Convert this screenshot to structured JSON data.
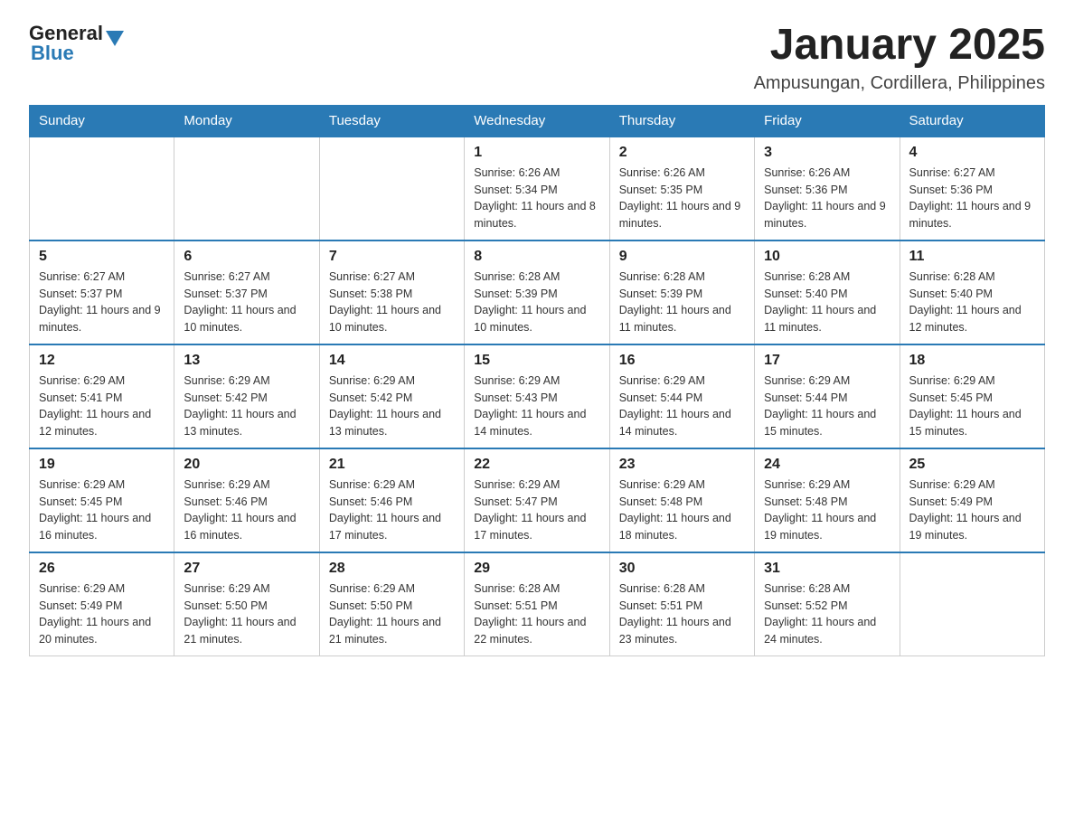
{
  "header": {
    "logo_general": "General",
    "logo_blue": "Blue",
    "title": "January 2025",
    "subtitle": "Ampusungan, Cordillera, Philippines"
  },
  "days_of_week": [
    "Sunday",
    "Monday",
    "Tuesday",
    "Wednesday",
    "Thursday",
    "Friday",
    "Saturday"
  ],
  "weeks": [
    [
      {
        "day": "",
        "info": ""
      },
      {
        "day": "",
        "info": ""
      },
      {
        "day": "",
        "info": ""
      },
      {
        "day": "1",
        "info": "Sunrise: 6:26 AM\nSunset: 5:34 PM\nDaylight: 11 hours and 8 minutes."
      },
      {
        "day": "2",
        "info": "Sunrise: 6:26 AM\nSunset: 5:35 PM\nDaylight: 11 hours and 9 minutes."
      },
      {
        "day": "3",
        "info": "Sunrise: 6:26 AM\nSunset: 5:36 PM\nDaylight: 11 hours and 9 minutes."
      },
      {
        "day": "4",
        "info": "Sunrise: 6:27 AM\nSunset: 5:36 PM\nDaylight: 11 hours and 9 minutes."
      }
    ],
    [
      {
        "day": "5",
        "info": "Sunrise: 6:27 AM\nSunset: 5:37 PM\nDaylight: 11 hours and 9 minutes."
      },
      {
        "day": "6",
        "info": "Sunrise: 6:27 AM\nSunset: 5:37 PM\nDaylight: 11 hours and 10 minutes."
      },
      {
        "day": "7",
        "info": "Sunrise: 6:27 AM\nSunset: 5:38 PM\nDaylight: 11 hours and 10 minutes."
      },
      {
        "day": "8",
        "info": "Sunrise: 6:28 AM\nSunset: 5:39 PM\nDaylight: 11 hours and 10 minutes."
      },
      {
        "day": "9",
        "info": "Sunrise: 6:28 AM\nSunset: 5:39 PM\nDaylight: 11 hours and 11 minutes."
      },
      {
        "day": "10",
        "info": "Sunrise: 6:28 AM\nSunset: 5:40 PM\nDaylight: 11 hours and 11 minutes."
      },
      {
        "day": "11",
        "info": "Sunrise: 6:28 AM\nSunset: 5:40 PM\nDaylight: 11 hours and 12 minutes."
      }
    ],
    [
      {
        "day": "12",
        "info": "Sunrise: 6:29 AM\nSunset: 5:41 PM\nDaylight: 11 hours and 12 minutes."
      },
      {
        "day": "13",
        "info": "Sunrise: 6:29 AM\nSunset: 5:42 PM\nDaylight: 11 hours and 13 minutes."
      },
      {
        "day": "14",
        "info": "Sunrise: 6:29 AM\nSunset: 5:42 PM\nDaylight: 11 hours and 13 minutes."
      },
      {
        "day": "15",
        "info": "Sunrise: 6:29 AM\nSunset: 5:43 PM\nDaylight: 11 hours and 14 minutes."
      },
      {
        "day": "16",
        "info": "Sunrise: 6:29 AM\nSunset: 5:44 PM\nDaylight: 11 hours and 14 minutes."
      },
      {
        "day": "17",
        "info": "Sunrise: 6:29 AM\nSunset: 5:44 PM\nDaylight: 11 hours and 15 minutes."
      },
      {
        "day": "18",
        "info": "Sunrise: 6:29 AM\nSunset: 5:45 PM\nDaylight: 11 hours and 15 minutes."
      }
    ],
    [
      {
        "day": "19",
        "info": "Sunrise: 6:29 AM\nSunset: 5:45 PM\nDaylight: 11 hours and 16 minutes."
      },
      {
        "day": "20",
        "info": "Sunrise: 6:29 AM\nSunset: 5:46 PM\nDaylight: 11 hours and 16 minutes."
      },
      {
        "day": "21",
        "info": "Sunrise: 6:29 AM\nSunset: 5:46 PM\nDaylight: 11 hours and 17 minutes."
      },
      {
        "day": "22",
        "info": "Sunrise: 6:29 AM\nSunset: 5:47 PM\nDaylight: 11 hours and 17 minutes."
      },
      {
        "day": "23",
        "info": "Sunrise: 6:29 AM\nSunset: 5:48 PM\nDaylight: 11 hours and 18 minutes."
      },
      {
        "day": "24",
        "info": "Sunrise: 6:29 AM\nSunset: 5:48 PM\nDaylight: 11 hours and 19 minutes."
      },
      {
        "day": "25",
        "info": "Sunrise: 6:29 AM\nSunset: 5:49 PM\nDaylight: 11 hours and 19 minutes."
      }
    ],
    [
      {
        "day": "26",
        "info": "Sunrise: 6:29 AM\nSunset: 5:49 PM\nDaylight: 11 hours and 20 minutes."
      },
      {
        "day": "27",
        "info": "Sunrise: 6:29 AM\nSunset: 5:50 PM\nDaylight: 11 hours and 21 minutes."
      },
      {
        "day": "28",
        "info": "Sunrise: 6:29 AM\nSunset: 5:50 PM\nDaylight: 11 hours and 21 minutes."
      },
      {
        "day": "29",
        "info": "Sunrise: 6:28 AM\nSunset: 5:51 PM\nDaylight: 11 hours and 22 minutes."
      },
      {
        "day": "30",
        "info": "Sunrise: 6:28 AM\nSunset: 5:51 PM\nDaylight: 11 hours and 23 minutes."
      },
      {
        "day": "31",
        "info": "Sunrise: 6:28 AM\nSunset: 5:52 PM\nDaylight: 11 hours and 24 minutes."
      },
      {
        "day": "",
        "info": ""
      }
    ]
  ]
}
